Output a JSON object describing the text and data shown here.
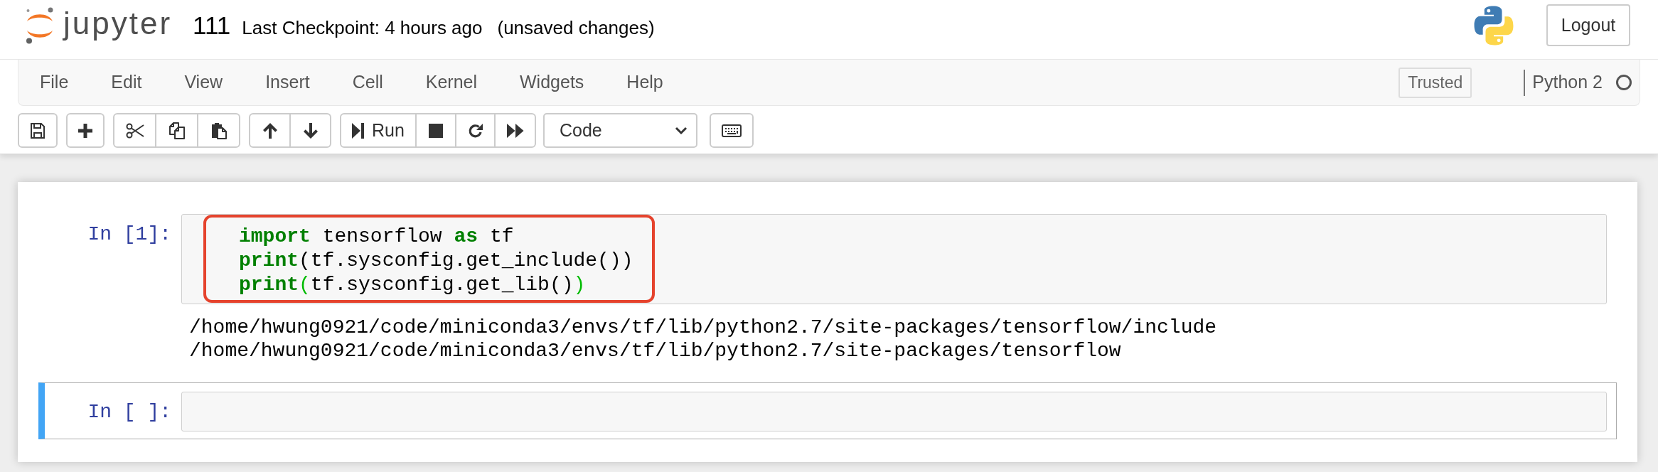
{
  "header": {
    "logo_text": "jupyter",
    "notebook_name": "111",
    "checkpoint": "Last Checkpoint: 4 hours ago",
    "save_status": "(unsaved changes)",
    "logout": "Logout"
  },
  "menubar": {
    "items": [
      "File",
      "Edit",
      "View",
      "Insert",
      "Cell",
      "Kernel",
      "Widgets",
      "Help"
    ],
    "trusted": "Trusted",
    "kernel_name": "Python 2",
    "kernel_busy": false
  },
  "toolbar": {
    "groups": [
      [
        {
          "kind": "save"
        }
      ],
      [
        {
          "kind": "insert"
        }
      ],
      [
        {
          "kind": "cut"
        },
        {
          "kind": "copy"
        },
        {
          "kind": "paste"
        }
      ],
      [
        {
          "kind": "move-up"
        },
        {
          "kind": "move-down"
        }
      ],
      [
        {
          "kind": "run",
          "label": "Run"
        },
        {
          "kind": "interrupt"
        },
        {
          "kind": "restart"
        },
        {
          "kind": "run-all"
        }
      ]
    ],
    "cell_type": "Code",
    "groups_after_select": [
      [
        {
          "kind": "keyboard"
        }
      ]
    ]
  },
  "cells": [
    {
      "prompt": "In [1]:",
      "selected": false,
      "highlighted": true,
      "code": [
        [
          {
            "kind": "keyword",
            "text": "import"
          },
          {
            "kind": "plain",
            "text": " tensorflow "
          },
          {
            "kind": "keyword",
            "text": "as"
          },
          {
            "kind": "plain",
            "text": " tf"
          }
        ],
        [
          {
            "kind": "keyword",
            "text": "print"
          },
          {
            "kind": "plain",
            "text": "(tf.sysconfig.get_include())"
          }
        ],
        [
          {
            "kind": "keyword",
            "text": "print"
          },
          {
            "kind": "bracket-match",
            "text": "("
          },
          {
            "kind": "plain",
            "text": "tf.sysconfig.get_lib()"
          },
          {
            "kind": "bracket-match",
            "text": ")"
          }
        ]
      ],
      "output": [
        "/home/hwung0921/code/miniconda3/envs/tf/lib/python2.7/site-packages/tensorflow/include",
        "/home/hwung0921/code/miniconda3/envs/tf/lib/python2.7/site-packages/tensorflow"
      ]
    },
    {
      "prompt": "In [ ]:",
      "selected": true,
      "highlighted": false
    }
  ]
}
